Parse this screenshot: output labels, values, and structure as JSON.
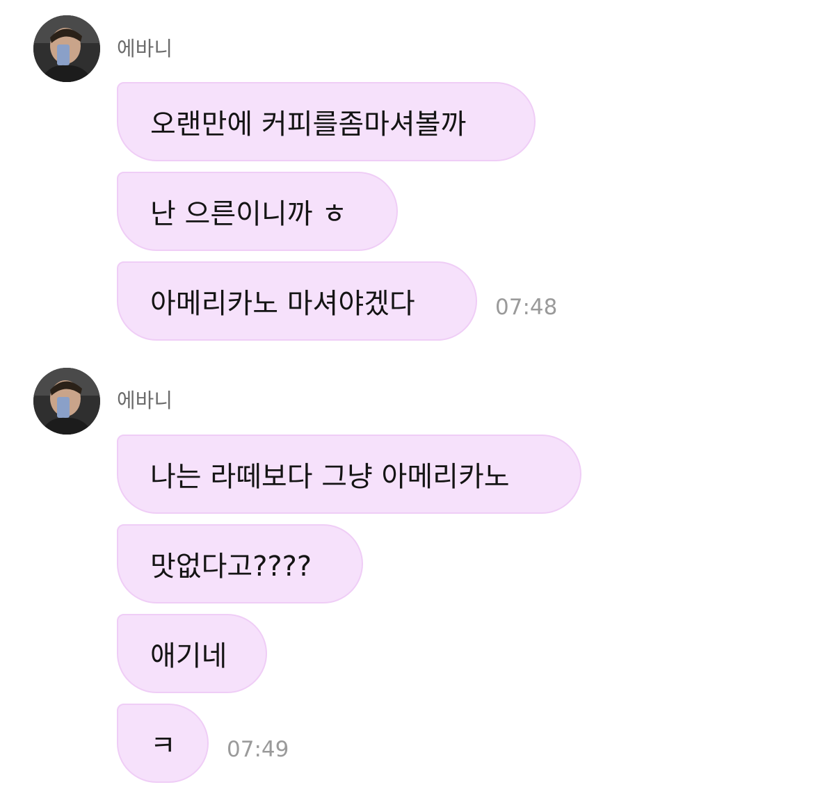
{
  "groups": [
    {
      "sender": "에바니",
      "messages": [
        "오랜만에 커피를좀마셔볼까",
        "난 으른이니까 ㅎ",
        "아메리카노 마셔야겠다"
      ],
      "time": "07:48"
    },
    {
      "sender": "에바니",
      "messages": [
        "나는 라떼보다 그냥 아메리카노",
        "맛없다고????",
        "애기네",
        "ㅋ"
      ],
      "time": "07:49"
    }
  ],
  "colors": {
    "bubble_bg": "#f6e1fb",
    "bubble_border": "#efcdf6",
    "sender_text": "#6b6b6b",
    "time_text": "#9a9a9a"
  },
  "icons": {
    "avatar": "profile-photo-avatar"
  }
}
